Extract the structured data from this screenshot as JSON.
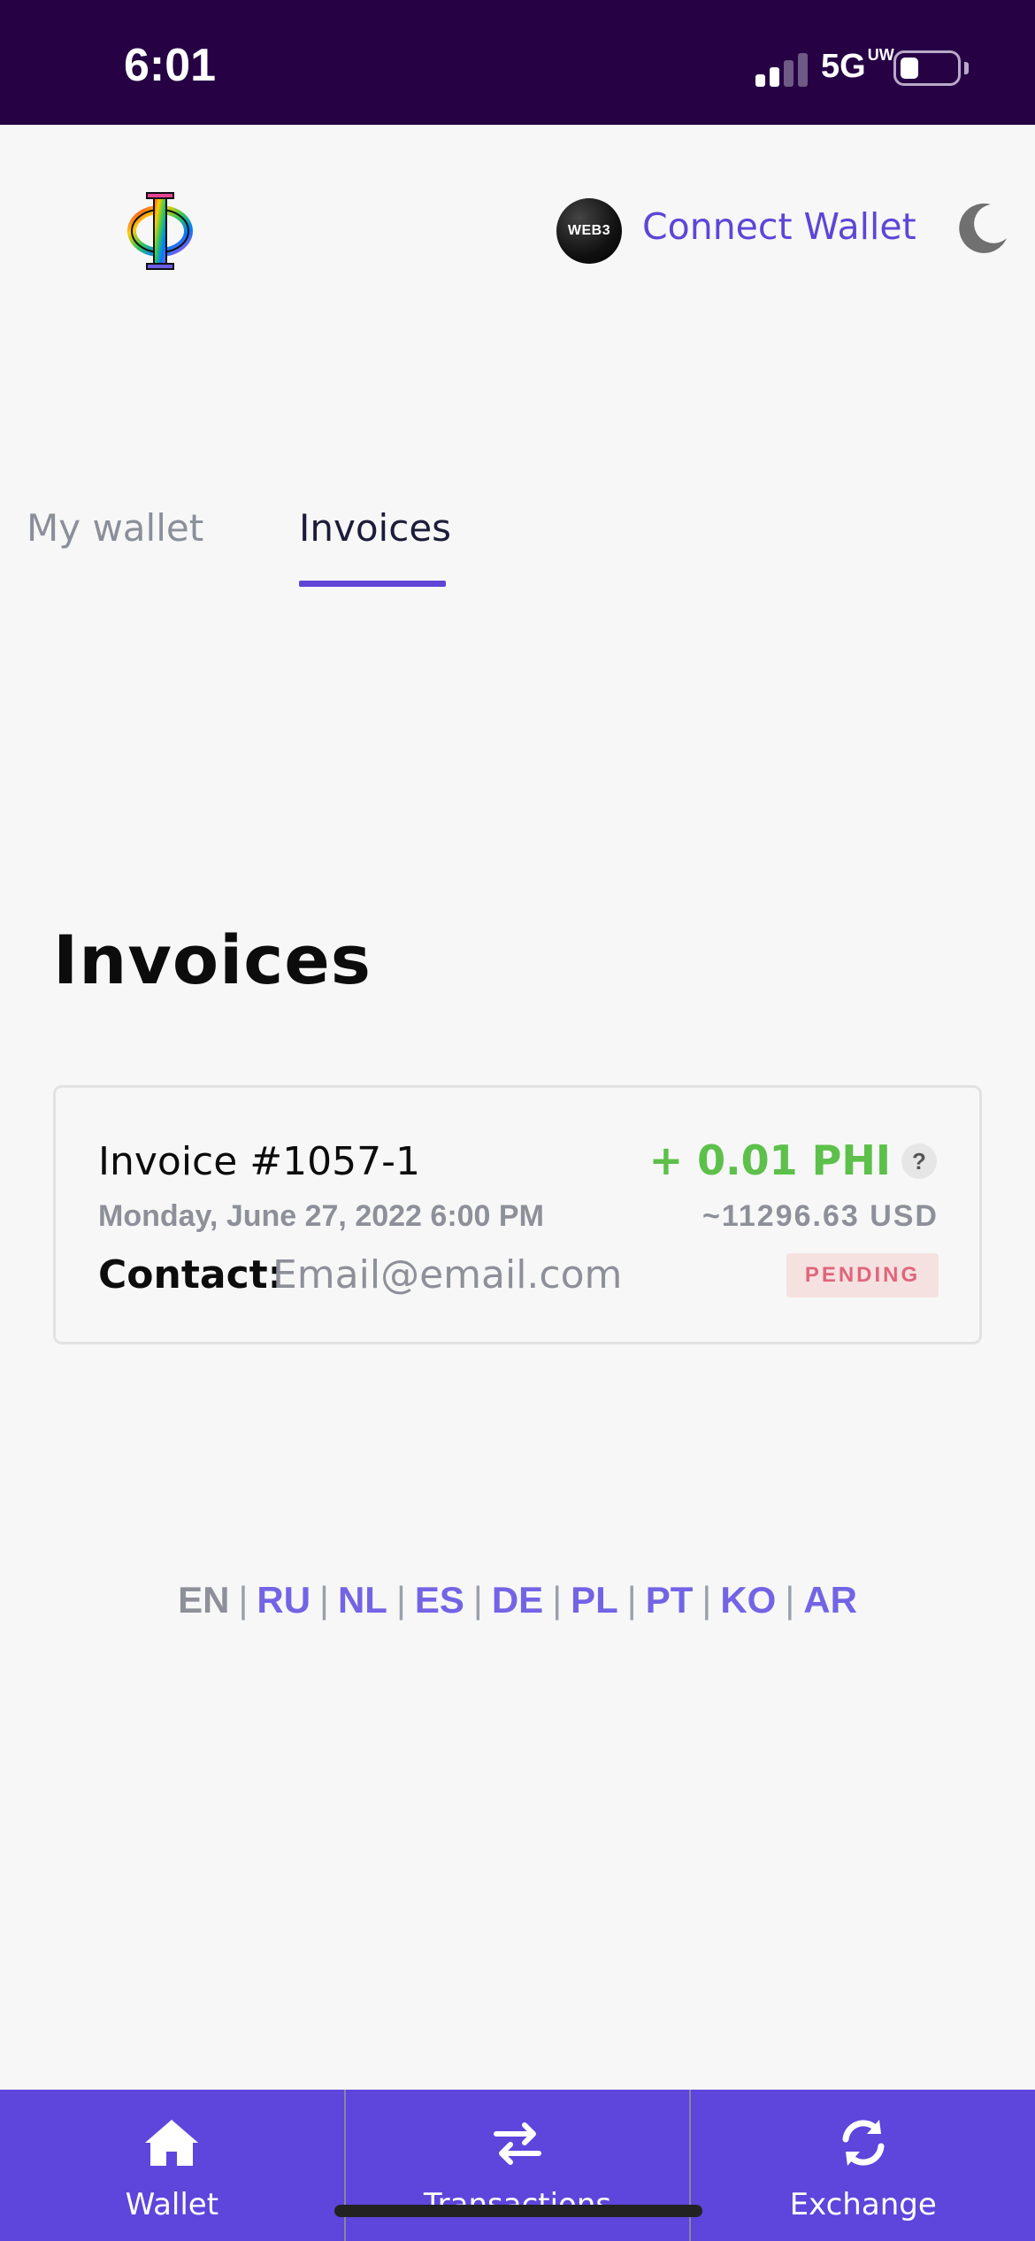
{
  "status_bar": {
    "time": "6:01",
    "network": "5G",
    "network_superscript": "UW",
    "battery_level": 0.2
  },
  "header": {
    "web3_badge": "WEB3",
    "connect_wallet_label": "Connect Wallet",
    "theme_toggle_icon": "moon-icon"
  },
  "tabs": [
    {
      "label": "My wallet",
      "active": false
    },
    {
      "label": "Invoices",
      "active": true
    }
  ],
  "section_title": "Invoices",
  "invoices": [
    {
      "title": "Invoice #1057-1",
      "date": "Monday, June 27, 2022 6:00 PM",
      "contact_label": "Contact:",
      "contact_value": "Email@email.com",
      "amount": "+ 0.01 PHI",
      "help": "?",
      "usd": "~11296.63 USD",
      "status": "PENDING"
    }
  ],
  "languages": {
    "items": [
      "EN",
      "RU",
      "NL",
      "ES",
      "DE",
      "PL",
      "PT",
      "KO",
      "AR"
    ],
    "active": "EN"
  },
  "bottom_nav": [
    {
      "label": "Wallet",
      "icon": "home-icon"
    },
    {
      "label": "Transactions",
      "icon": "transfer-arrows-icon"
    },
    {
      "label": "Exchange",
      "icon": "refresh-icon"
    }
  ],
  "colors": {
    "accent": "#5e45d7",
    "status_bar": "#260245",
    "positive": "#5cc04a",
    "pending": "#e0657b"
  }
}
